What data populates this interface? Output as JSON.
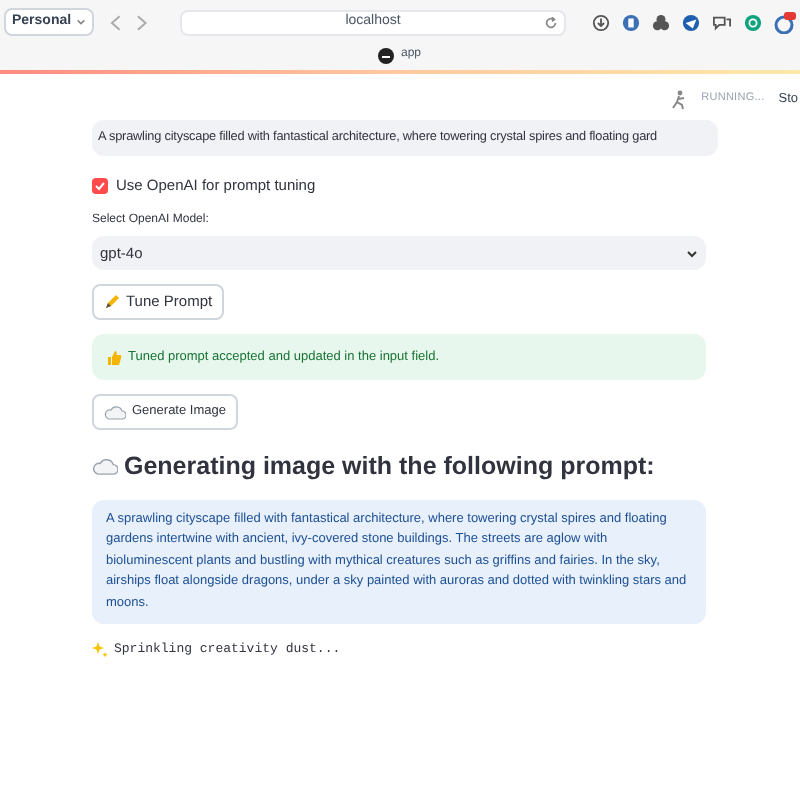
{
  "browser": {
    "profile": "Personal",
    "url": "localhost",
    "tab_title": "app"
  },
  "status": {
    "label": "RUNNING...",
    "stop": "Sto"
  },
  "prompt_input": {
    "value": "A sprawling cityscape filled with fantastical architecture, where towering crystal spires and floating gard"
  },
  "checkbox": {
    "label": "Use OpenAI for prompt tuning",
    "checked": true
  },
  "model_select": {
    "label": "Select OpenAI Model:",
    "value": "gpt-4o"
  },
  "tune_button": {
    "label": "Tune Prompt"
  },
  "success": {
    "text": "Tuned prompt accepted and updated in the input field."
  },
  "generate_button": {
    "label": "Generate Image"
  },
  "heading": "Generating image with the following prompt:",
  "info": {
    "text": "A sprawling cityscape filled with fantastical architecture, where towering crystal spires and floating gardens intertwine with ancient, ivy-covered stone buildings. The streets are aglow with bioluminescent plants and bustling with mythical creatures such as griffins and fairies. In the sky, airships float alongside dragons, under a sky painted with auroras and dotted with twinkling stars and moons."
  },
  "spinner": {
    "text": "Sprinkling creativity dust..."
  }
}
